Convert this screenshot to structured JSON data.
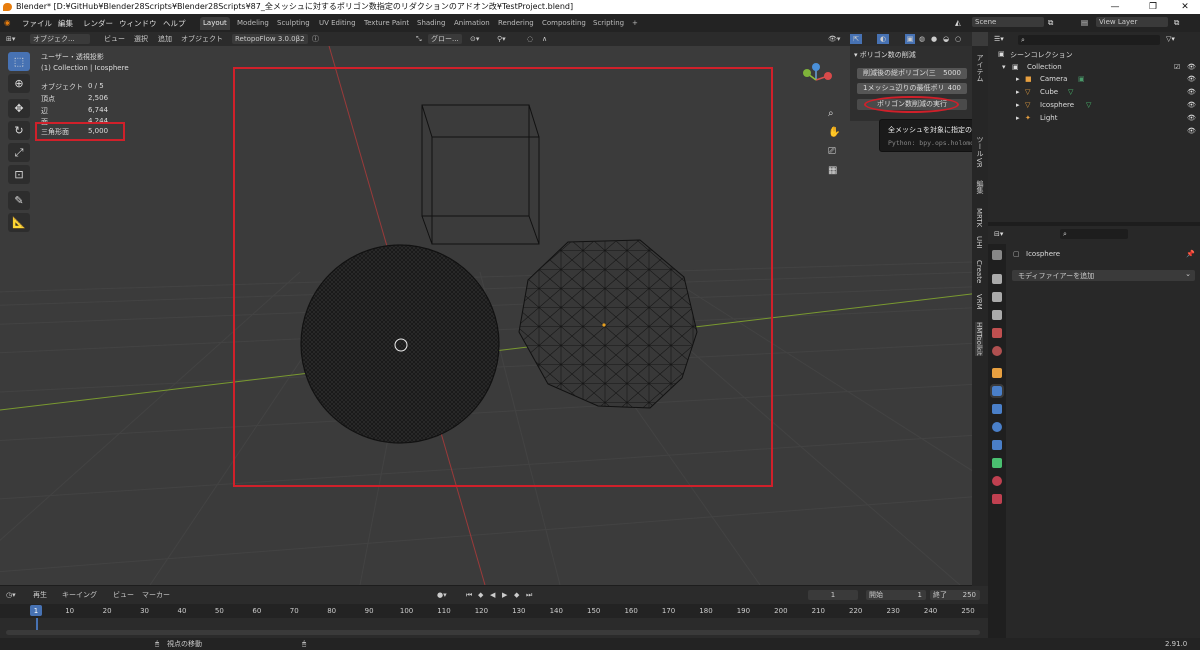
{
  "window": {
    "title": "Blender* [D:¥GitHub¥Blender28Scripts¥Blender28Scripts¥87_全メッシュに対するポリゴン数指定のリダクションのアドオン改¥TestProject.blend]",
    "controls": [
      "—",
      "❐",
      "✕"
    ]
  },
  "menu": [
    "ファイル",
    "編集",
    "レンダー",
    "ウィンドウ",
    "ヘルプ"
  ],
  "workspaces": [
    "Layout",
    "Modeling",
    "Sculpting",
    "UV Editing",
    "Texture Paint",
    "Shading",
    "Animation",
    "Rendering",
    "Compositing",
    "Scripting",
    "+"
  ],
  "scene": {
    "name": "Scene",
    "view_layer": "View Layer"
  },
  "viewport_header": {
    "mode": "オブジェク...",
    "menus": [
      "ビュー",
      "選択",
      "追加",
      "オブジェクト"
    ],
    "addon": "RetopoFlow 3.0.0β2",
    "orientation": "グロー..."
  },
  "overlay": {
    "view_name": "ユーザー・透視投影",
    "collection": "(1) Collection | Icosphere",
    "stats": [
      {
        "label": "オブジェクト",
        "value": "0 / 5"
      },
      {
        "label": "頂点",
        "value": "2,506"
      },
      {
        "label": "辺",
        "value": "6,744"
      },
      {
        "label": "面",
        "value": "4,244"
      },
      {
        "label": "三角形面",
        "value": "5,000"
      }
    ]
  },
  "npanel": {
    "title": "ポリゴン数の削減",
    "field1_label": "削減後の総ポリゴン(三",
    "field1_value": "5000",
    "field2_label": "1メッシュ辺りの最低ポリ",
    "field2_value": "400",
    "button": "ポリゴン数削減の実行"
  },
  "tooltip": {
    "text": "全メッシュを対象に指定のポリゴン数までの削減を行います。",
    "python": "Python: bpy.ops.holomon.decimate_mesh()"
  },
  "side_tabs": [
    "アイテム",
    "ツール",
    "VR",
    "編集",
    "MRTK",
    "UHI",
    "Create",
    "VRM",
    "HMToolkit"
  ],
  "outliner": {
    "header": "シーンコレクション",
    "collection": "Collection",
    "items": [
      "Camera",
      "Cube",
      "Icosphere",
      "Light"
    ]
  },
  "properties": {
    "object_name": "Icosphere",
    "add_modifier": "モディファイアーを追加"
  },
  "timeline": {
    "menus": [
      "再生",
      "キーイング",
      "ビュー",
      "マーカー"
    ],
    "current_frame": "1",
    "start_label": "開始",
    "start": "1",
    "end_label": "終了",
    "end": "250",
    "ticks": [
      "1",
      "10",
      "20",
      "30",
      "40",
      "50",
      "60",
      "70",
      "80",
      "90",
      "100",
      "110",
      "120",
      "130",
      "140",
      "150",
      "160",
      "170",
      "180",
      "190",
      "200",
      "210",
      "220",
      "230",
      "240",
      "250"
    ]
  },
  "status": {
    "hint": "視点の移動",
    "version": "2.91.0"
  }
}
